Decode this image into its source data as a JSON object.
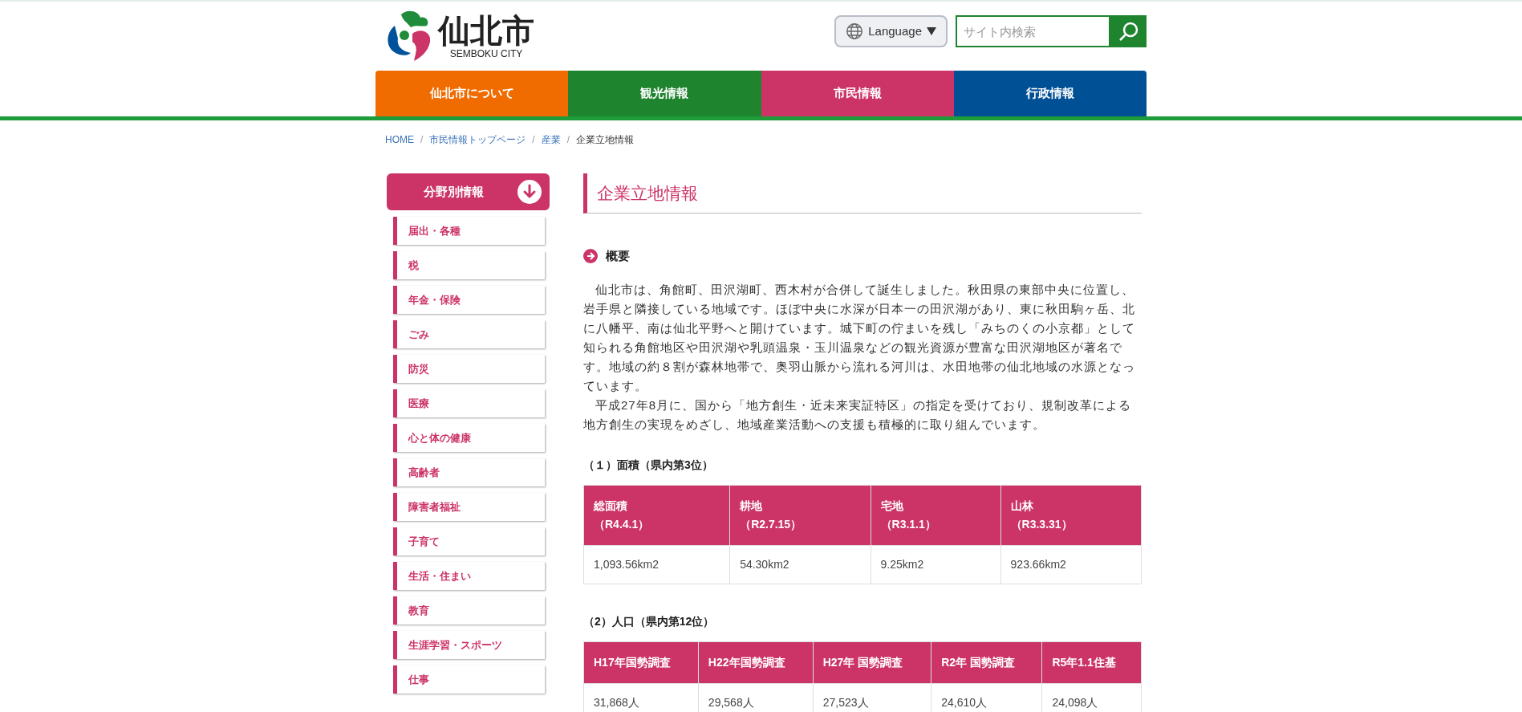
{
  "header": {
    "logo_name": "仙北市",
    "logo_sub": "SEMBOKU CITY",
    "language_button": "Language",
    "search": {
      "placeholder": "サイト内検索"
    }
  },
  "nav": [
    {
      "label": "仙北市について",
      "color": "#f06c00"
    },
    {
      "label": "観光情報",
      "color": "#1e842e"
    },
    {
      "label": "市民情報",
      "color": "#cc3366"
    },
    {
      "label": "行政情報",
      "color": "#005096"
    }
  ],
  "breadcrumb": {
    "separator": "/",
    "items": [
      {
        "label": "HOME",
        "link": true
      },
      {
        "label": "市民情報トップページ",
        "link": true
      },
      {
        "label": "産業",
        "link": true
      },
      {
        "label": "企業立地情報",
        "link": false
      }
    ]
  },
  "sidebar": {
    "title": "分野別情報",
    "items": [
      "届出・各種",
      "税",
      "年金・保険",
      "ごみ",
      "防災",
      "医療",
      "心と体の健康",
      "高齢者",
      "障害者福祉",
      "子育て",
      "生活・住まい",
      "教育",
      "生涯学習・スポーツ",
      "仕事"
    ]
  },
  "main": {
    "title": "企業立地情報",
    "section_heading": "概要",
    "paragraphs": [
      "仙北市は、角館町、田沢湖町、西木村が合併して誕生しました。秋田県の東部中央に位置し、岩手県と隣接している地域です。ほぼ中央に水深が日本一の田沢湖があり、東に秋田駒ヶ岳、北に八幡平、南は仙北平野へと開けています。城下町の佇まいを残し「みちのくの小京都」として知られる角館地区や田沢湖や乳頭温泉・玉川温泉などの観光資源が豊富な田沢湖地区が著名です。地域の約８割が森林地帯で、奥羽山脈から流れる河川は、水田地帯の仙北地域の水源となっています。",
      "平成27年8月に、国から「地方創生・近未来実証特区」の指定を受けており、規制改革による地方創生の実現をめざし、地域産業活動への支援も積極的に取り組んでいます。"
    ],
    "tables": [
      {
        "caption": "（１）面積（県内第3位）",
        "columns": [
          {
            "label": "総面積",
            "date": "（R4.4.1）"
          },
          {
            "label": "耕地",
            "date": "（R2.7.15）"
          },
          {
            "label": "宅地",
            "date": "（R3.1.1）"
          },
          {
            "label": "山林",
            "date": "（R3.3.31）"
          }
        ],
        "row": [
          "1,093.56km2",
          "54.30km2",
          "9.25km2",
          "923.66km2"
        ]
      },
      {
        "caption": "（2）人口（県内第12位）",
        "columns": [
          {
            "label": "H17年国勢調査"
          },
          {
            "label": "H22年国勢調査"
          },
          {
            "label": "H27年 国勢調査"
          },
          {
            "label": "R2年 国勢調査"
          },
          {
            "label": "R5年1.1住基"
          }
        ],
        "row": [
          "31,868人",
          "29,568人",
          "27,523人",
          "24,610人",
          "24,098人"
        ]
      }
    ]
  }
}
